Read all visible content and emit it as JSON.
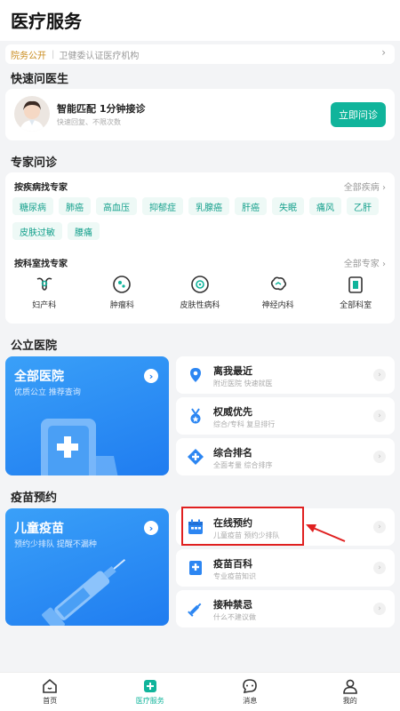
{
  "header": {
    "title": "医疗服务"
  },
  "notice": {
    "tag": "院务公开",
    "text": "卫健委认证医疗机构"
  },
  "quick": {
    "section_title": "快速问医生",
    "headline": "智能匹配 1分钟接诊",
    "subline": "快速回复、不限次数",
    "button_label": "立即问诊"
  },
  "expert": {
    "section_title": "专家问诊",
    "by_disease_title": "按疾病找专家",
    "by_disease_more": "全部疾病",
    "diseases": [
      "糖尿病",
      "肺癌",
      "高血压",
      "抑郁症",
      "乳腺癌",
      "肝癌",
      "失眠",
      "痛风",
      "乙肝",
      "皮肤过敏",
      "腰痛"
    ],
    "by_dept_title": "按科室找专家",
    "by_dept_more": "全部专家",
    "departments": [
      "妇产科",
      "肿瘤科",
      "皮肤性病科",
      "神经内科",
      "全部科室"
    ]
  },
  "hospital": {
    "section_title": "公立医院",
    "big_title": "全部医院",
    "big_sub": "优质公立 推荐查询",
    "rows": [
      {
        "title": "离我最近",
        "sub": "附近医院 快速就医"
      },
      {
        "title": "权威优先",
        "sub": "综合/专科 复旦排行"
      },
      {
        "title": "综合排名",
        "sub": "全面考量 综合排序"
      }
    ]
  },
  "vaccine": {
    "section_title": "疫苗预约",
    "big_title": "儿童疫苗",
    "big_sub": "预约少排队 提醒不漏种",
    "rows": [
      {
        "title": "在线预约",
        "sub": "儿童疫苗 预约少排队"
      },
      {
        "title": "疫苗百科",
        "sub": "专业疫苗知识"
      },
      {
        "title": "接种禁忌",
        "sub": "什么不建议做"
      }
    ]
  },
  "tabbar": [
    {
      "label": "首页",
      "icon": "home-icon"
    },
    {
      "label": "医疗服务",
      "icon": "medical-icon"
    },
    {
      "label": "消息",
      "icon": "message-icon"
    },
    {
      "label": "我的",
      "icon": "profile-icon"
    }
  ],
  "colors": {
    "accent": "#10b49b",
    "blue": "#1f7cf0",
    "highlight": "#e02020"
  }
}
